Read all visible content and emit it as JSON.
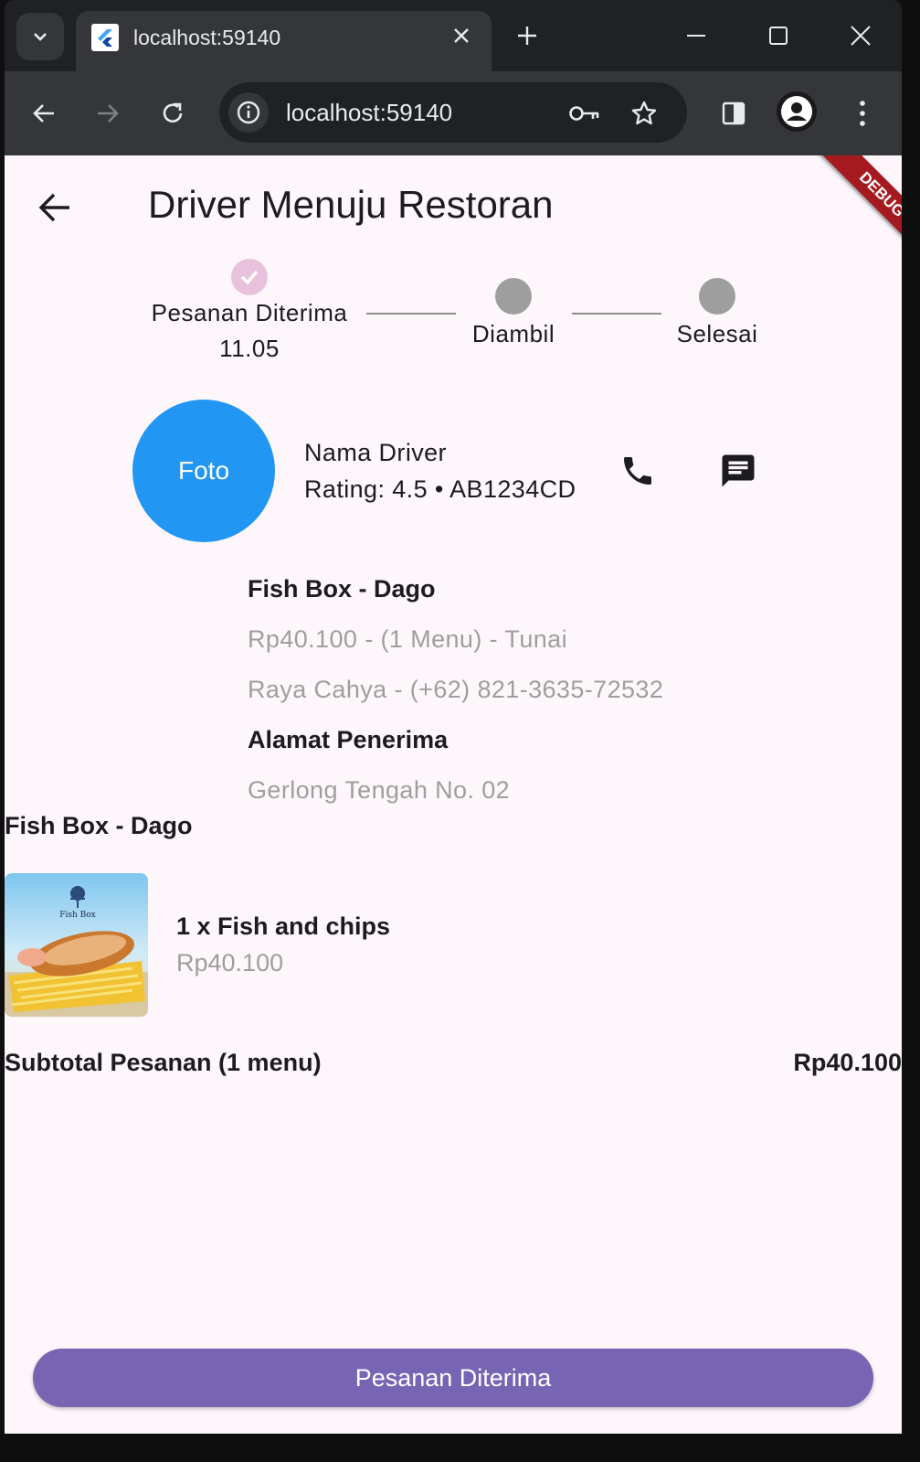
{
  "browser": {
    "tab_title": "localhost:59140",
    "url": "localhost:59140",
    "icons": [
      "tab-search-icon",
      "flutter-favicon",
      "close-icon",
      "plus-icon",
      "minimize-icon",
      "maximize-icon",
      "close-window-icon",
      "back-arrow-icon",
      "forward-arrow-icon",
      "reload-icon",
      "info-icon",
      "key-icon",
      "star-icon",
      "side-panel-icon",
      "profile-icon",
      "more-vert-icon"
    ]
  },
  "app": {
    "title": "Driver Menuju Restoran",
    "debug_banner": "DEBUG",
    "stepper": {
      "steps": [
        {
          "label": "Pesanan Diterima",
          "time": "11.05",
          "state": "done"
        },
        {
          "label": "Diambil",
          "state": "pending"
        },
        {
          "label": "Selesai",
          "state": "pending"
        }
      ]
    },
    "driver": {
      "photo_label": "Foto",
      "name": "Nama Driver",
      "rating": "Rating: 4.5 • AB1234CD"
    },
    "order_info": {
      "restaurant": "Fish Box - Dago",
      "summary": "Rp40.100 - (1 Menu) - Tunai",
      "customer": "Raya Cahya - (+62) 821-3635-72532",
      "address_heading": "Alamat Penerima",
      "address": "Gerlong Tengah No. 02"
    },
    "order_detail": {
      "restaurant": "Fish Box - Dago",
      "items": [
        {
          "name": "1 x Fish and chips",
          "price": "Rp40.100",
          "image_caption": "Fish Box"
        }
      ],
      "subtotal_label": "Subtotal Pesanan (1 menu)",
      "subtotal_value": "Rp40.100"
    },
    "primary_button": "Pesanan Diterima"
  },
  "colors": {
    "accent": "#7765b3",
    "driver_photo": "#2196f3",
    "step_done": "#e8c2dc",
    "step_pending": "#9e9e9e",
    "debug": "#a51a1f",
    "background": "#fdf7fc"
  }
}
